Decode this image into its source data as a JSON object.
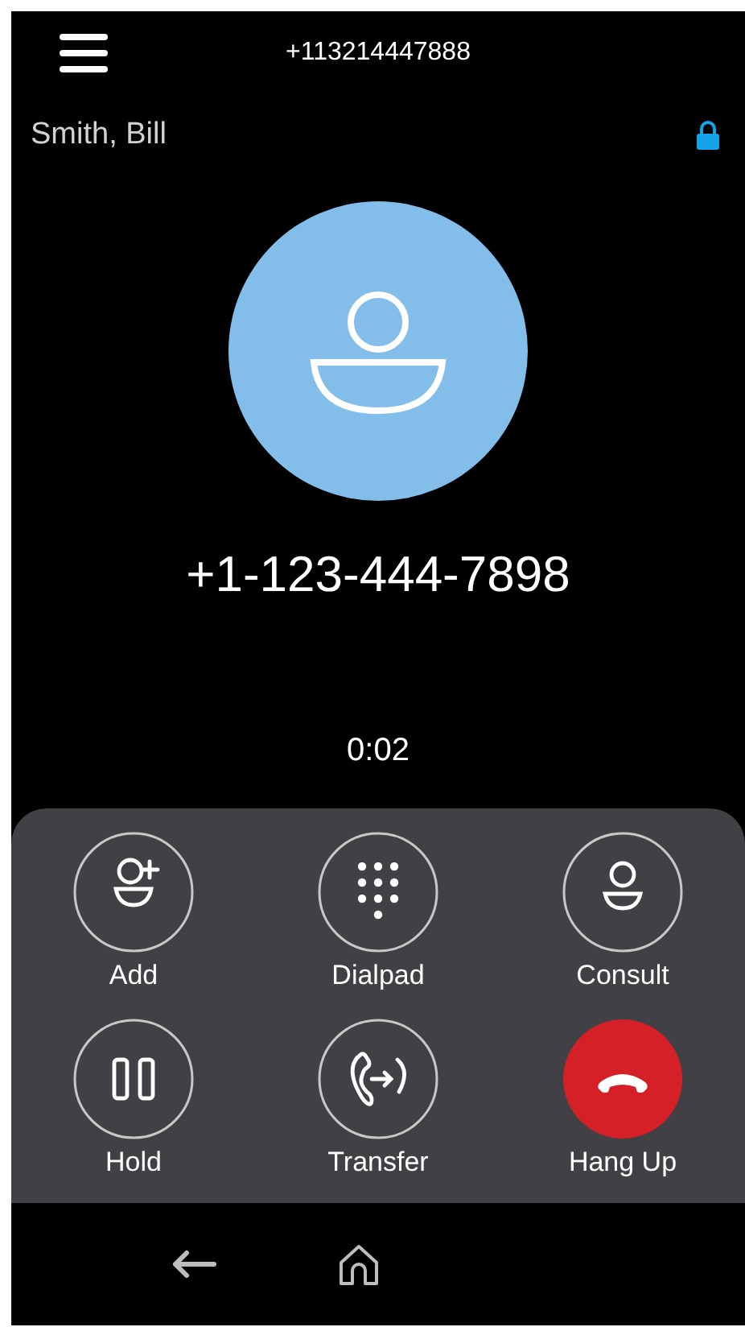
{
  "header": {
    "title": "+113214447888"
  },
  "caller": {
    "name": "Smith, Bill",
    "number": "+1-123-444-7898",
    "duration": "0:02"
  },
  "actions": [
    {
      "label": "Add",
      "kind": "add"
    },
    {
      "label": "Dialpad",
      "kind": "dialpad"
    },
    {
      "label": "Consult",
      "kind": "consult"
    },
    {
      "label": "Hold",
      "kind": "hold"
    },
    {
      "label": "Transfer",
      "kind": "transfer"
    },
    {
      "label": "Hang Up",
      "kind": "hangup"
    }
  ]
}
